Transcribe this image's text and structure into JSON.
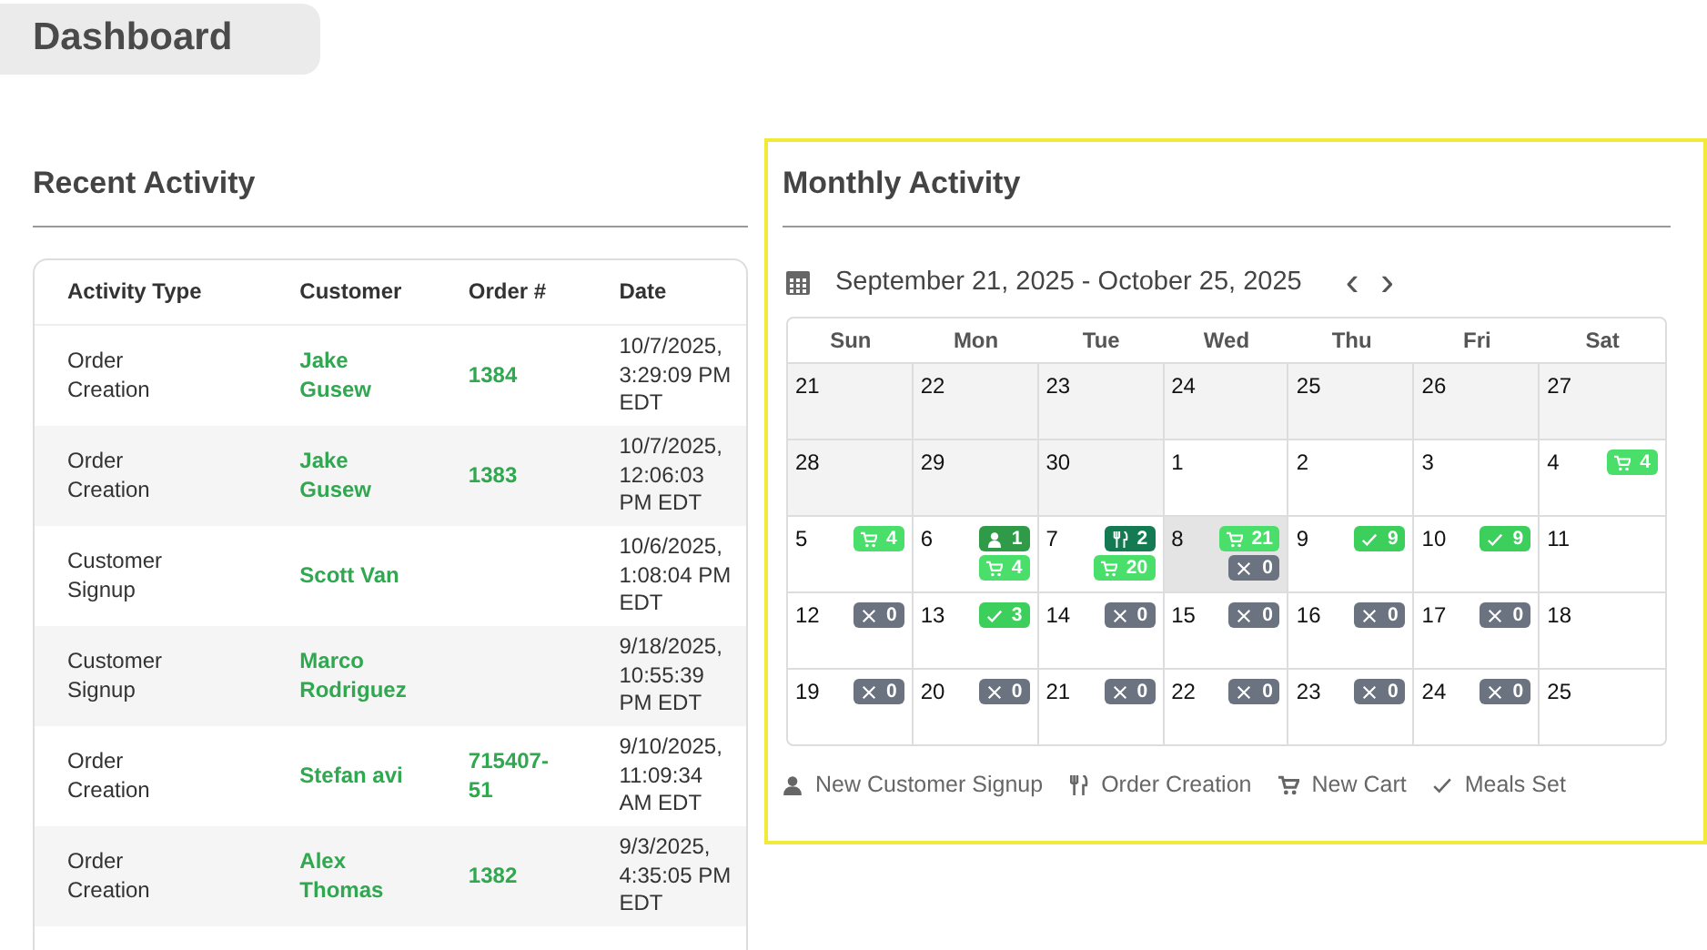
{
  "header": {
    "title": "Dashboard"
  },
  "recent_activity": {
    "title": "Recent Activity",
    "columns": [
      "Activity Type",
      "Customer",
      "Order #",
      "Date"
    ],
    "rows": [
      {
        "activity_type": "Order Creation",
        "customer": "Jake Gusew",
        "order": "1384",
        "date": "10/7/2025, 3:29:09 PM EDT"
      },
      {
        "activity_type": "Order Creation",
        "customer": "Jake Gusew",
        "order": "1383",
        "date": "10/7/2025, 12:06:03 PM EDT"
      },
      {
        "activity_type": "Customer Signup",
        "customer": "Scott Van",
        "date": "10/6/2025, 1:08:04 PM EDT"
      },
      {
        "activity_type": "Customer Signup",
        "customer": "Marco Rodriguez",
        "date": "9/18/2025, 10:55:39 PM EDT"
      },
      {
        "activity_type": "Order Creation",
        "customer": "Stefan avi",
        "order": "715407-51",
        "date": "9/10/2025, 11:09:34 AM EDT"
      },
      {
        "activity_type": "Order Creation",
        "customer": "Alex Thomas",
        "order": "1382",
        "date": "9/3/2025, 4:35:05 PM EDT"
      }
    ]
  },
  "monthly_activity": {
    "title": "Monthly Activity",
    "range": "September 21, 2025 - October 25, 2025",
    "prev": "‹",
    "next": "›",
    "weekdays": [
      "Sun",
      "Mon",
      "Tue",
      "Wed",
      "Thu",
      "Fri",
      "Sat"
    ],
    "weeks": [
      [
        {
          "day": "21",
          "past": true,
          "today": false
        },
        {
          "day": "22",
          "past": true,
          "today": false
        },
        {
          "day": "23",
          "past": true,
          "today": false
        },
        {
          "day": "24",
          "past": true,
          "today": false
        },
        {
          "day": "25",
          "past": true,
          "today": false
        },
        {
          "day": "26",
          "past": true,
          "today": false
        },
        {
          "day": "27",
          "past": true,
          "today": false
        }
      ],
      [
        {
          "day": "28",
          "past": true,
          "today": false
        },
        {
          "day": "29",
          "past": true,
          "today": false
        },
        {
          "day": "30",
          "past": true,
          "today": false
        },
        {
          "day": "1",
          "past": false,
          "today": false
        },
        {
          "day": "2",
          "past": false,
          "today": false
        },
        {
          "day": "3",
          "past": false,
          "today": false
        },
        {
          "day": "4",
          "past": false,
          "today": false,
          "events": [
            {
              "kind": "cart",
              "count": "4"
            }
          ]
        }
      ],
      [
        {
          "day": "5",
          "past": false,
          "today": false,
          "events": [
            {
              "kind": "cart",
              "count": "4"
            }
          ]
        },
        {
          "day": "6",
          "past": false,
          "today": false,
          "events": [
            {
              "kind": "signup",
              "count": "1"
            },
            {
              "kind": "cart",
              "count": "4"
            }
          ]
        },
        {
          "day": "7",
          "past": false,
          "today": false,
          "events": [
            {
              "kind": "order",
              "count": "2"
            },
            {
              "kind": "cart",
              "count": "20"
            }
          ]
        },
        {
          "day": "8",
          "past": false,
          "today": true,
          "events": [
            {
              "kind": "cart",
              "count": "21"
            },
            {
              "kind": "none",
              "count": "0"
            }
          ]
        },
        {
          "day": "9",
          "past": false,
          "today": false,
          "events": [
            {
              "kind": "meals",
              "count": "9"
            }
          ]
        },
        {
          "day": "10",
          "past": false,
          "today": false,
          "events": [
            {
              "kind": "meals",
              "count": "9"
            }
          ]
        },
        {
          "day": "11",
          "past": false,
          "today": false
        }
      ],
      [
        {
          "day": "12",
          "past": false,
          "today": false,
          "events": [
            {
              "kind": "none",
              "count": "0"
            }
          ]
        },
        {
          "day": "13",
          "past": false,
          "today": false,
          "events": [
            {
              "kind": "meals",
              "count": "3"
            }
          ]
        },
        {
          "day": "14",
          "past": false,
          "today": false,
          "events": [
            {
              "kind": "none",
              "count": "0"
            }
          ]
        },
        {
          "day": "15",
          "past": false,
          "today": false,
          "events": [
            {
              "kind": "none",
              "count": "0"
            }
          ]
        },
        {
          "day": "16",
          "past": false,
          "today": false,
          "events": [
            {
              "kind": "none",
              "count": "0"
            }
          ]
        },
        {
          "day": "17",
          "past": false,
          "today": false,
          "events": [
            {
              "kind": "none",
              "count": "0"
            }
          ]
        },
        {
          "day": "18",
          "past": false,
          "today": false
        }
      ],
      [
        {
          "day": "19",
          "past": false,
          "today": false,
          "events": [
            {
              "kind": "none",
              "count": "0"
            }
          ]
        },
        {
          "day": "20",
          "past": false,
          "today": false,
          "events": [
            {
              "kind": "none",
              "count": "0"
            }
          ]
        },
        {
          "day": "21",
          "past": false,
          "today": false,
          "events": [
            {
              "kind": "none",
              "count": "0"
            }
          ]
        },
        {
          "day": "22",
          "past": false,
          "today": false,
          "events": [
            {
              "kind": "none",
              "count": "0"
            }
          ]
        },
        {
          "day": "23",
          "past": false,
          "today": false,
          "events": [
            {
              "kind": "none",
              "count": "0"
            }
          ]
        },
        {
          "day": "24",
          "past": false,
          "today": false,
          "events": [
            {
              "kind": "none",
              "count": "0"
            }
          ]
        },
        {
          "day": "25",
          "past": false,
          "today": false
        }
      ]
    ],
    "legend": [
      {
        "kind": "signup",
        "label": "New Customer Signup"
      },
      {
        "kind": "order",
        "label": "Order Creation"
      },
      {
        "kind": "cart",
        "label": "New Cart"
      },
      {
        "kind": "meals",
        "label": "Meals Set"
      }
    ]
  }
}
